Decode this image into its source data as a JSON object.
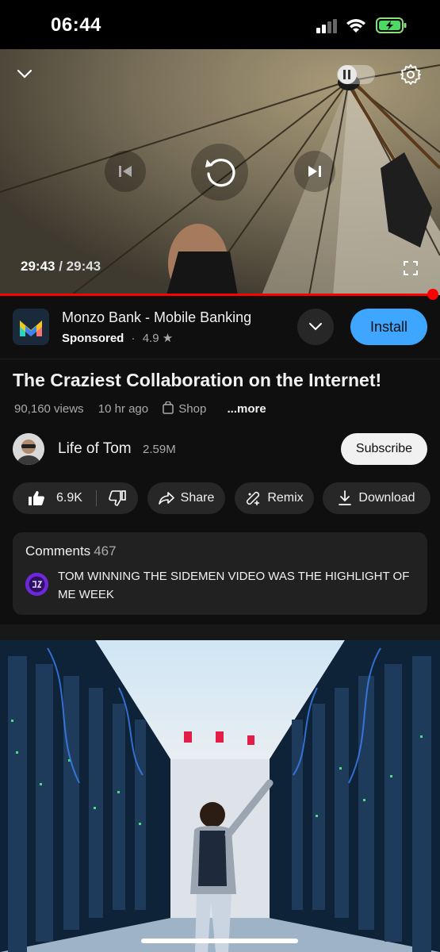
{
  "status_bar": {
    "time": "06:44"
  },
  "player": {
    "current_time": "29:43",
    "separator": " / ",
    "duration": "29:43",
    "progress": 1.0,
    "accent": "#ff0000"
  },
  "ad": {
    "title": "Monzo Bank - Mobile Banking",
    "label": "Sponsored",
    "rating": "4.9",
    "install_label": "Install",
    "brand_color": "#3ea6ff"
  },
  "video": {
    "title": "The Craziest Collaboration on the Internet!",
    "views": "90,160 views",
    "age": "10 hr ago",
    "shop": "Shop",
    "more": "...more"
  },
  "channel": {
    "name": "Life of Tom",
    "subscribers": "2.59M",
    "subscribe_label": "Subscribe"
  },
  "actions": {
    "likes": "6.9K",
    "share": "Share",
    "remix": "Remix",
    "download": "Download"
  },
  "comments": {
    "title": "Comments",
    "count": "467",
    "top_comment": "TOM WINNING THE SIDEMEN VIDEO WAS THE HIGHLIGHT OF ME WEEK"
  },
  "icons": [
    "chevron-down-icon",
    "pause-toggle-icon",
    "gear-icon",
    "previous-icon",
    "replay-icon",
    "next-icon",
    "fullscreen-icon",
    "star-icon",
    "shop-icon",
    "like-icon",
    "dislike-icon",
    "share-icon",
    "remix-icon",
    "download-icon"
  ]
}
